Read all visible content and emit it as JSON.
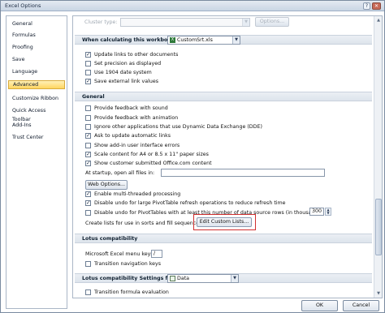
{
  "window": {
    "title": "Excel Options"
  },
  "nav": {
    "items": [
      {
        "label": "General"
      },
      {
        "label": "Formulas"
      },
      {
        "label": "Proofing"
      },
      {
        "label": "Save"
      },
      {
        "label": "Language"
      },
      {
        "label": "Advanced",
        "active": true
      },
      {
        "label": "Customize Ribbon"
      },
      {
        "label": "Quick Access Toolbar"
      },
      {
        "label": "Add-Ins"
      },
      {
        "label": "Trust Center"
      }
    ]
  },
  "top": {
    "cluster_label": "Cluster type:",
    "options_button": "Options..."
  },
  "workbook_section": {
    "header": "When calculating this workbook:",
    "workbook_select": "CustomSrt.xls",
    "options": [
      {
        "label": "Update links to other documents",
        "checked": true
      },
      {
        "label": "Set precision as displayed",
        "checked": false
      },
      {
        "label": "Use 1904 date system",
        "checked": false
      },
      {
        "label": "Save external link values",
        "checked": true
      }
    ]
  },
  "general_section": {
    "header": "General",
    "options": [
      {
        "label": "Provide feedback with sound",
        "checked": false
      },
      {
        "label": "Provide feedback with animation",
        "checked": false
      },
      {
        "label": "Ignore other applications that use Dynamic Data Exchange (DDE)",
        "checked": false
      },
      {
        "label": "Ask to update automatic links",
        "checked": true
      },
      {
        "label": "Show add-in user interface errors",
        "checked": false
      },
      {
        "label": "Scale content for A4 or 8.5 x 11\" paper sizes",
        "checked": true
      },
      {
        "label": "Show customer submitted Office.com content",
        "checked": true
      }
    ],
    "startup_label": "At startup, open all files in:",
    "startup_value": "",
    "web_options_button": "Web Options...",
    "options2": [
      {
        "label": "Enable multi-threaded processing",
        "checked": true
      },
      {
        "label": "Disable undo for large PivotTable refresh operations to reduce refresh time",
        "checked": true
      },
      {
        "label": "Disable undo for PivotTables with at least this number of data source rows (in thousands):",
        "checked": false
      }
    ],
    "rows_value": "300",
    "custom_lists_label": "Create lists for use in sorts and fill sequences:",
    "custom_lists_button": "Edit Custom Lists..."
  },
  "lotus_section": {
    "header": "Lotus compatibility",
    "menu_key_label": "Microsoft Excel menu key:",
    "menu_key_value": "/",
    "transition_nav_label": "Transition navigation keys",
    "transition_nav_checked": false
  },
  "lotus_settings_section": {
    "header": "Lotus compatibility Settings for:",
    "sheet_select": "Data",
    "formula_eval_label": "Transition formula evaluation",
    "formula_eval_checked": false
  },
  "footer": {
    "ok": "OK",
    "cancel": "Cancel"
  },
  "colors": {
    "active_nav": "#ffd660",
    "highlight": "#d03030"
  }
}
